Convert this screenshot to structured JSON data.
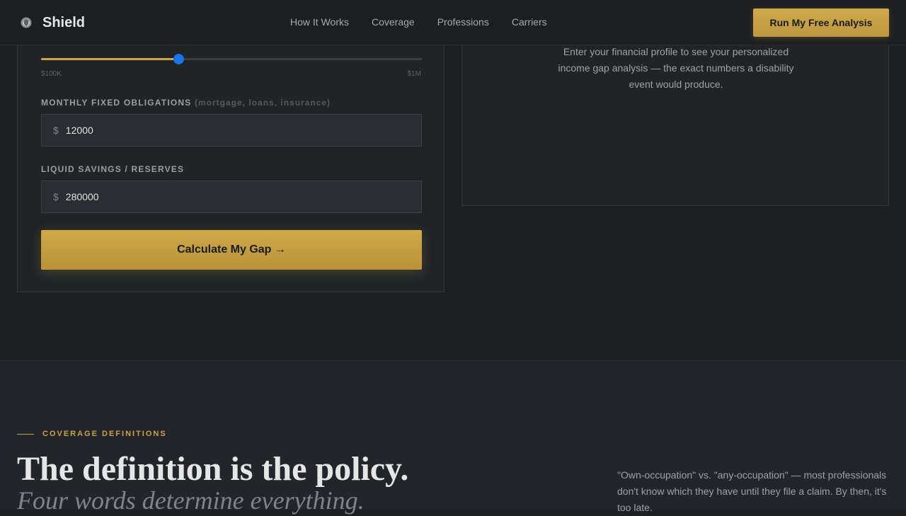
{
  "nav": {
    "brand": "Shield",
    "links": [
      "How It Works",
      "Coverage",
      "Professions",
      "Carriers"
    ],
    "cta": "Run My Free Analysis"
  },
  "form": {
    "slider": {
      "min_label": "$100K",
      "max_label": "$1M",
      "value_fraction": 0.36
    },
    "obligations": {
      "label": "MONTHLY FIXED OBLIGATIONS",
      "hint": "(mortgage, loans, insurance)",
      "prefix": "$",
      "value": "12000"
    },
    "savings": {
      "label": "LIQUID SAVINGS / RESERVES",
      "prefix": "$",
      "value": "280000"
    },
    "submit": "Calculate My Gap →"
  },
  "result": {
    "placeholder": "Enter your financial profile to see your personalized income gap analysis — the exact numbers a disability event would produce."
  },
  "definitions": {
    "eyebrow": "COVERAGE DEFINITIONS",
    "headline": "The definition is the policy.",
    "subheadline": "Four words determine everything.",
    "body": "\"Own-occupation\" vs. \"any-occupation\" — most professionals don't know which they have until they file a claim. By then, it's too late."
  },
  "colors": {
    "accent": "#c9a24a",
    "slider_thumb": "#1a73e8",
    "background": "#1d1f22"
  }
}
